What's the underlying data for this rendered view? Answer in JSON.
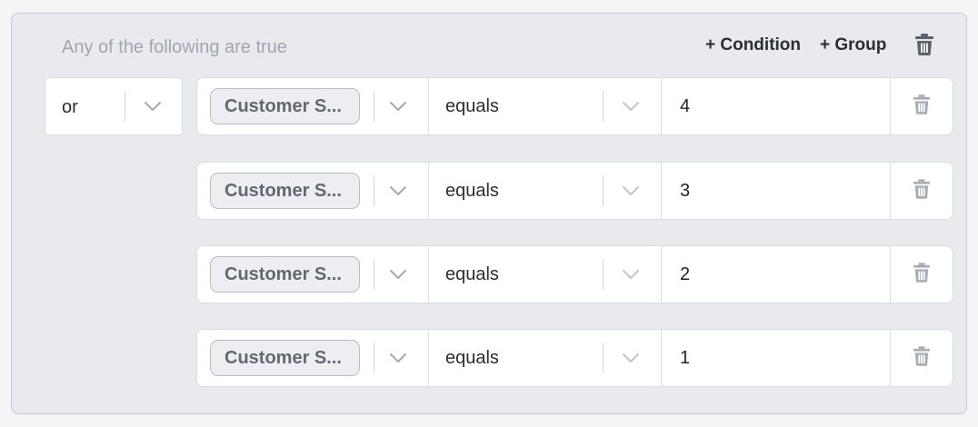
{
  "group": {
    "title": "Any of the following are true",
    "add_condition_label": "+ Condition",
    "add_group_label": "+ Group",
    "delete_icon": "trash-icon"
  },
  "combinator": {
    "value": "or",
    "icon": "chevron-down-icon"
  },
  "conditions": [
    {
      "field": "Customer S...",
      "operator": "equals",
      "value": "4"
    },
    {
      "field": "Customer S...",
      "operator": "equals",
      "value": "3"
    },
    {
      "field": "Customer S...",
      "operator": "equals",
      "value": "2"
    },
    {
      "field": "Customer S...",
      "operator": "equals",
      "value": "1"
    }
  ],
  "colors": {
    "panel_bg": "#e8eaee",
    "panel_border": "#c6cad1",
    "chip_bg": "#eceef1",
    "muted_text": "#a2a6ae",
    "trash_active": "#5e626a",
    "trash_row": "#a9adb4"
  }
}
